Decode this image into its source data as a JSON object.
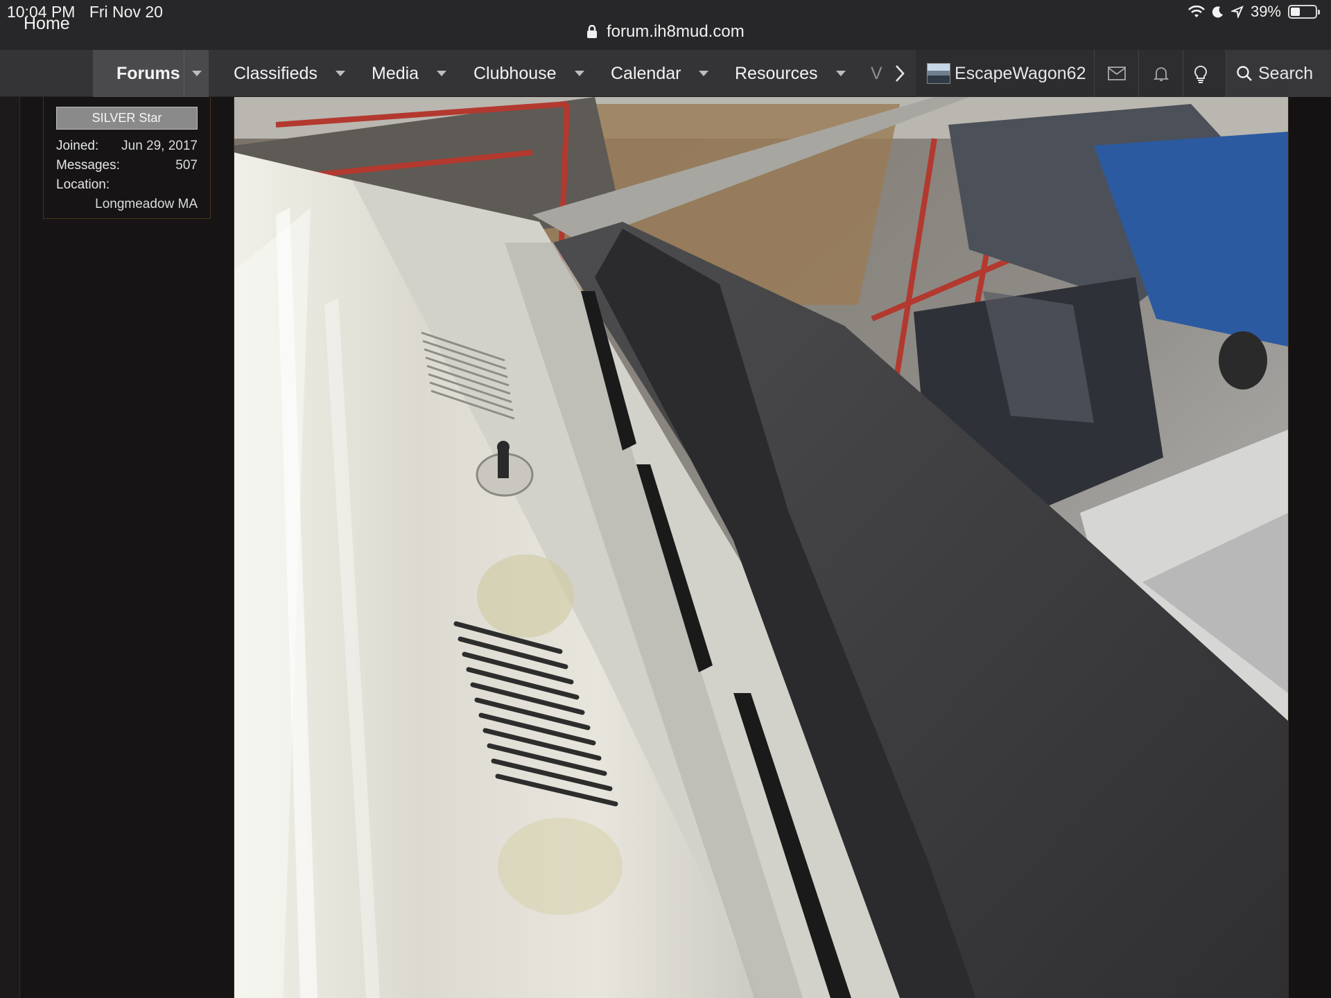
{
  "status_bar": {
    "time": "10:04 PM",
    "date": "Fri Nov 20",
    "battery": "39%",
    "battery_level": 0.39
  },
  "browser": {
    "url": "forum.ih8mud.com"
  },
  "nav": {
    "items": [
      {
        "label": "Home"
      },
      {
        "label": "Forums"
      },
      {
        "label": "Classifieds"
      },
      {
        "label": "Media"
      },
      {
        "label": "Clubhouse"
      },
      {
        "label": "Calendar"
      },
      {
        "label": "Resources"
      },
      {
        "label": "V"
      }
    ],
    "username": "EscapeWagon62",
    "search_label": "Search"
  },
  "user_info": {
    "badge": "SILVER Star",
    "joined_label": "Joined:",
    "joined_value": "Jun 29, 2017",
    "messages_label": "Messages:",
    "messages_value": "507",
    "location_label": "Location:",
    "location_value": "Longmeadow MA"
  },
  "colors": {
    "nav_bg": "#343437",
    "active_tab": "#4a4a4d",
    "page_bg": "#1c1a1a",
    "badge_bg": "#8a8a8a"
  },
  "icons": [
    "lock-icon",
    "wifi-icon",
    "moon-icon",
    "location-arrow-icon",
    "battery-icon",
    "caret-down-icon",
    "chevron-right-icon",
    "mail-icon",
    "bell-icon",
    "lightbulb-icon",
    "search-icon"
  ]
}
